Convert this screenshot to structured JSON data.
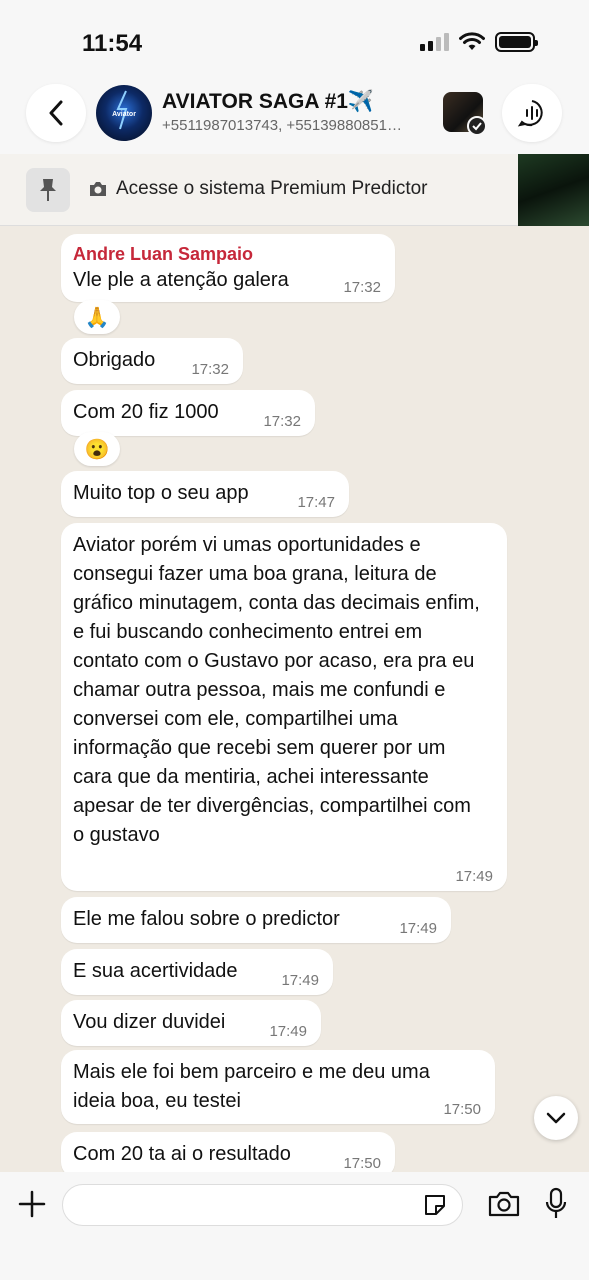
{
  "status_bar": {
    "time": "11:54"
  },
  "header": {
    "title": "AVIATOR SAGA #1✈️",
    "subtitle": "+5511987013743, +55139880851…",
    "avatar_text": "Aviator"
  },
  "pinned": {
    "text": "Acesse o sistema Premium Predictor"
  },
  "messages": [
    {
      "sender": "Andre Luan Sampaio",
      "text": "Vle ple a atenção  galera",
      "time": "17:32",
      "reaction": "🙏"
    },
    {
      "text": "Obrigado",
      "time": "17:32"
    },
    {
      "text": "Com 20 fiz 1000",
      "time": "17:32",
      "reaction": "😮"
    },
    {
      "text": "Muito top o seu app",
      "time": "17:47"
    },
    {
      "text": "Aviator  porém vi umas oportunidades  e consegui fazer uma boa grana, leitura de gráfico minutagem, conta das decimais enfim, e fui buscando conhecimento entrei em contato com o Gustavo por acaso, era pra eu chamar outra pessoa, mais me confundi e conversei com ele, compartilhei uma informação  que recebi sem querer por um cara que da mentiria, achei interessante  apesar de ter divergências,  compartilhei com o gustavo",
      "time": "17:49"
    },
    {
      "text": "Ele me falou sobre o predictor",
      "time": "17:49"
    },
    {
      "text": "E sua acertividade",
      "time": "17:49"
    },
    {
      "text": "Vou dizer duvidei",
      "time": "17:49"
    },
    {
      "text": "Mais ele foi bem parceiro e me deu uma ideia boa, eu testei",
      "time": "17:50"
    },
    {
      "text": "Com 20 ta ai o resultado",
      "time": "17:50"
    }
  ],
  "composer": {
    "placeholder": "",
    "value": ""
  },
  "colors": {
    "sender": "#c6283a",
    "chat_bg": "#efeae2",
    "bubble": "#ffffff"
  }
}
